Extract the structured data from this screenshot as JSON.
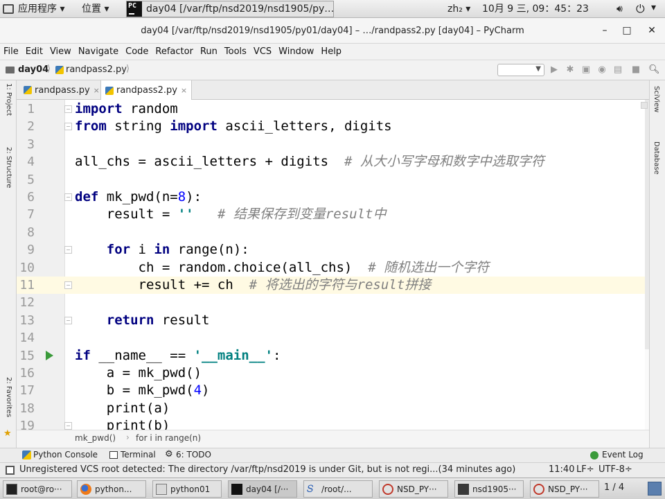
{
  "system_panel": {
    "apps_menu": "应用程序 ▾",
    "places_menu": "位置 ▾",
    "active_window": "day04 [/var/ftp/nsd2019/nsd1905/py…",
    "input_method": "zh₂ ▾",
    "datetime": "10月  9 三, 09：45：23",
    "volume_icon": "volume-icon",
    "power_icon": "power-icon"
  },
  "window": {
    "title": "day04 [/var/ftp/nsd2019/nsd1905/py01/day04] – …/randpass2.py [day04] – PyCharm",
    "minimize": "–",
    "maximize": "□",
    "close": "✕"
  },
  "menubar": [
    "File",
    "Edit",
    "View",
    "Navigate",
    "Code",
    "Refactor",
    "Run",
    "Tools",
    "VCS",
    "Window",
    "Help"
  ],
  "navbar": {
    "project": "day04",
    "file": "randpass2.py"
  },
  "left_stripe": {
    "project": "1: Project",
    "structure": "2: Structure",
    "favorites": "2: Favorites"
  },
  "right_stripe": {
    "sciview": "SciView",
    "database": "Database"
  },
  "tabs": [
    {
      "label": "randpass.py",
      "close": "×"
    },
    {
      "label": "randpass2.py",
      "close": "×"
    }
  ],
  "editor": {
    "line_numbers": [
      "1",
      "2",
      "3",
      "4",
      "5",
      "6",
      "7",
      "8",
      "9",
      "10",
      "11",
      "12",
      "13",
      "14",
      "15",
      "16",
      "17",
      "18",
      "19"
    ],
    "current_line": 11,
    "code": {
      "l1_kw": "import",
      "l1_rest": " random",
      "l2_kw1": "from",
      "l2_mid": " string ",
      "l2_kw2": "import",
      "l2_rest": " ascii_letters, digits",
      "l4_code": "all_chs = ascii_letters + digits  ",
      "l4_cm": "# 从大小写字母和数字中选取字符",
      "l6_kw": "def",
      "l6_a": " mk_pwd(n=",
      "l6_num": "8",
      "l6_b": "):",
      "l7_code": "    result = ",
      "l7_str": "''",
      "l7_gap": "   ",
      "l7_cm": "# 结果保存到变量result中",
      "l9_ind": "    ",
      "l9_kw1": "for",
      "l9_a": " i ",
      "l9_kw2": "in",
      "l9_b": " range(n):",
      "l10_code": "        ch = random.choice(all_chs)  ",
      "l10_cm": "# 随机选出一个字符",
      "l11_code": "        result += ch  ",
      "l11_cm": "# 将选出的字符与result拼接",
      "l13_ind": "    ",
      "l13_kw": "return",
      "l13_rest": " result",
      "l15_kw": "if",
      "l15_a": " __name__ == ",
      "l15_str": "'__main__'",
      "l15_b": ":",
      "l16_code": "    a = mk_pwd()",
      "l17_a": "    b = mk_pwd(",
      "l17_num": "4",
      "l17_b": ")",
      "l18_code": "    print(a)",
      "l19_code": "    print(b)"
    }
  },
  "editor_breadcrumb": {
    "func": "mk_pwd()",
    "loop": "for i in range(n)"
  },
  "tool_windows": {
    "python_console": "Python Console",
    "terminal": "Terminal",
    "todo": "6: TODO",
    "event_log": "Event Log"
  },
  "status": {
    "message": "Unregistered VCS root detected: The directory /var/ftp/nsd2019 is under Git, but is not regi...(34 minutes ago)",
    "position": "11:40",
    "line_sep": "LF÷",
    "encoding": "UTF-8÷"
  },
  "taskbar": [
    {
      "label": "root@ro···"
    },
    {
      "label": "python..."
    },
    {
      "label": "python01"
    },
    {
      "label": "day04 [/···"
    },
    {
      "label": "/root/..."
    },
    {
      "label": "NSD_PY···"
    },
    {
      "label": "nsd1905···"
    },
    {
      "label": "NSD_PY···"
    }
  ],
  "workspace": "1 / 4"
}
